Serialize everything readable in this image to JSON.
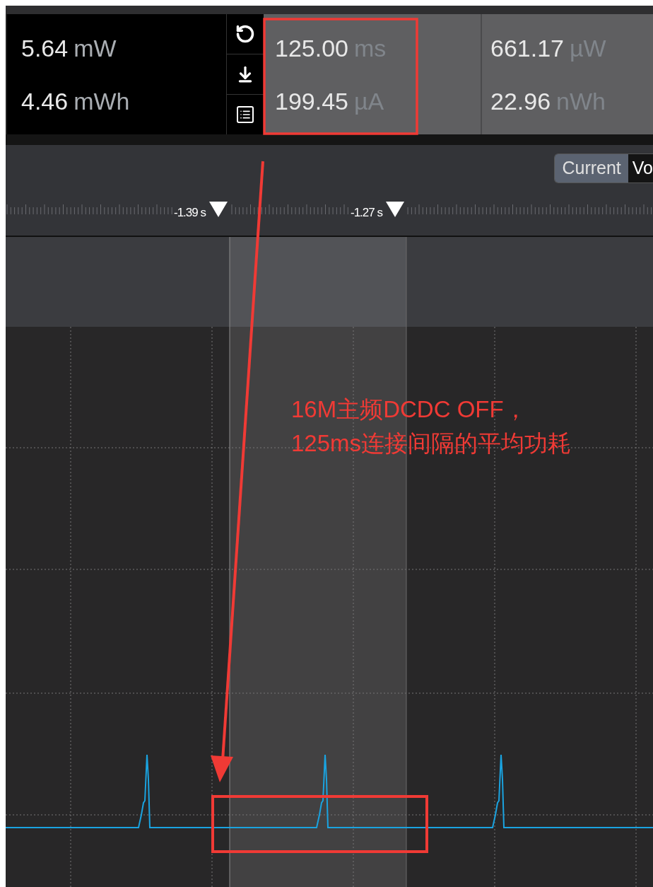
{
  "summary": [
    {
      "value": "5.64",
      "unit": "mW"
    },
    {
      "value": "4.46",
      "unit": "mWh"
    }
  ],
  "selection": [
    {
      "value": "125.00",
      "unit": "ms"
    },
    {
      "value": "199.45",
      "unit": "µA"
    }
  ],
  "window_stats": [
    {
      "value": "661.17",
      "unit": "µW"
    },
    {
      "value": "22.96",
      "unit": "nWh"
    }
  ],
  "channel_toggle": [
    {
      "label": "Current",
      "selected": true
    },
    {
      "label": "Vo",
      "selected": false
    }
  ],
  "markers": [
    {
      "label": "-1.39 s"
    },
    {
      "label": "-1.27 s"
    }
  ],
  "annotation": {
    "lines": [
      "16M主频DCDC OFF，",
      "125ms连接间隔的平均功耗"
    ]
  }
}
